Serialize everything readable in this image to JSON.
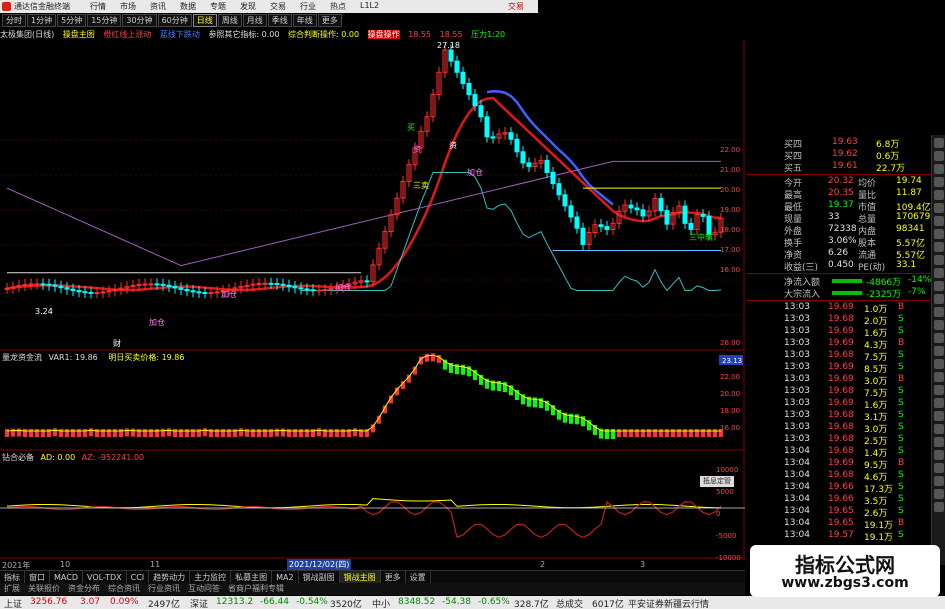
{
  "titlebar": {
    "app_title": "通达信金融终端",
    "menu": [
      "行情",
      "市场",
      "资讯",
      "数据",
      "专题",
      "发现",
      "交易",
      "行业",
      "热点",
      "L1L2"
    ],
    "right": "交易"
  },
  "periodbar": [
    "分时",
    "1分钟",
    "5分钟",
    "15分钟",
    "30分钟",
    "60分钟",
    "日线",
    "周线",
    "月线",
    "季线",
    "年线",
    "更多"
  ],
  "infoline": {
    "stock": "太极集团(日线)",
    "indicator": "操盘主图",
    "i1": "橙红线上涨动",
    "i2": "蓝线下跌动",
    "i3": "参照其它指标: 0.00",
    "i4": "综合判断操作: 0.00",
    "i5": "操盘操作",
    "v1": "18.55",
    "v2": "18.55",
    "pressure": "压力1:20"
  },
  "main_chart": {
    "peak_label": "27.18",
    "labels": {
      "buy": "买",
      "sell": "卖",
      "three_sell": "三卖",
      "three_buy1": "三中筑",
      "three_buy2": "三中筑",
      "add1": "加仓",
      "add2": "加仓",
      "add3": "加仓",
      "add4": "加仓",
      "low_label": "3.24",
      "fin": "财",
      "tag1": "资",
      "tag2": "资"
    },
    "y_ticks": [
      "22.00",
      "21.00",
      "20.00",
      "19.00",
      "18.00",
      "17.00",
      "16.00"
    ]
  },
  "sub1": {
    "title": "量龙资金流",
    "var1": "VAR1: 19.86",
    "var2": "明日买卖价格: 19.86",
    "y_ticks": [
      "26.00",
      "24.00",
      "22.00",
      "20.00",
      "18.00",
      "16.00"
    ],
    "highlight": "23.13"
  },
  "sub2": {
    "title": "钻合必备",
    "ad": "AD: 0.00",
    "az": "AZ: -952241.00",
    "y_ticks": [
      "10000",
      "5000",
      "0",
      "-5000",
      "-10000"
    ],
    "float_label": "抵息定管"
  },
  "dates": {
    "d1": "2021年",
    "d2": "10",
    "d3": "11",
    "d4": "2021/12/02(四)",
    "d5": "2",
    "d6": "3"
  },
  "quote": {
    "rows": [
      {
        "l": "买四",
        "p": "19.63",
        "v": "6.8万"
      },
      {
        "l": "买四",
        "p": "19.62",
        "v": "0.6万"
      },
      {
        "l": "买五",
        "p": "19.61",
        "v": "22.7万"
      }
    ],
    "stats": [
      {
        "l1": "今开",
        "v1": "20.32",
        "l2": "均价",
        "v2": "19.74"
      },
      {
        "l1": "最高",
        "v1": "20.35",
        "l2": "量比",
        "v2": "11.87"
      },
      {
        "l1": "最低",
        "v1": "19.37",
        "l2": "市值",
        "v2": "109.4亿"
      },
      {
        "l1": "现量",
        "v1": "33",
        "l2": "总量",
        "v2": "170679"
      },
      {
        "l1": "外盘",
        "v1": "72338",
        "l2": "内盘",
        "v2": "98341"
      },
      {
        "l1": "换手",
        "v1": "3.06%",
        "l2": "股本",
        "v2": "5.57亿"
      },
      {
        "l1": "净资",
        "v1": "6.26",
        "l2": "流通",
        "v2": "5.57亿"
      },
      {
        "l1": "收益(三)",
        "v1": "0.450",
        "l2": "PE(动)",
        "v2": "33.1"
      }
    ],
    "flow": [
      {
        "l": "净流入额",
        "v": "-4866万",
        "p": "-14%"
      },
      {
        "l": "大宗流入",
        "v": "-2325万",
        "p": "-7%"
      }
    ],
    "ticks": [
      {
        "t": "13:03",
        "p": "19.69",
        "v": "1.0万",
        "s": "B"
      },
      {
        "t": "13:03",
        "p": "19.68",
        "v": "2.0万",
        "s": "S"
      },
      {
        "t": "13:03",
        "p": "19.69",
        "v": "1.6万",
        "s": "S"
      },
      {
        "t": "13:03",
        "p": "19.69",
        "v": "4.3万",
        "s": "B"
      },
      {
        "t": "13:03",
        "p": "19.68",
        "v": "7.5万",
        "s": "S"
      },
      {
        "t": "13:03",
        "p": "19.69",
        "v": "8.5万",
        "s": "S"
      },
      {
        "t": "13:03",
        "p": "19.69",
        "v": "3.0万",
        "s": "B"
      },
      {
        "t": "13:03",
        "p": "19.68",
        "v": "7.5万",
        "s": "S"
      },
      {
        "t": "13:03",
        "p": "19.69",
        "v": "1.6万",
        "s": "S"
      },
      {
        "t": "13:03",
        "p": "19.68",
        "v": "3.1万",
        "s": "S"
      },
      {
        "t": "13:03",
        "p": "19.68",
        "v": "3.0万",
        "s": "S"
      },
      {
        "t": "13:03",
        "p": "19.68",
        "v": "2.5万",
        "s": "S"
      },
      {
        "t": "13:04",
        "p": "19.68",
        "v": "1.4万",
        "s": "S"
      },
      {
        "t": "13:04",
        "p": "19.69",
        "v": "9.5万",
        "s": "B"
      },
      {
        "t": "13:04",
        "p": "19.68",
        "v": "4.6万",
        "s": "S"
      },
      {
        "t": "13:04",
        "p": "19.66",
        "v": "17.3万",
        "s": "S"
      },
      {
        "t": "13:04",
        "p": "19.66",
        "v": "3.5万",
        "s": "S"
      },
      {
        "t": "13:04",
        "p": "19.65",
        "v": "2.6万",
        "s": "S"
      },
      {
        "t": "13:04",
        "p": "19.65",
        "v": "19.1万",
        "s": "B"
      },
      {
        "t": "13:04",
        "p": "19.57",
        "v": "19.1万",
        "s": "S"
      }
    ]
  },
  "tabs": [
    "指标",
    "窗口",
    "MACD",
    "VOL-TDX",
    "CCI",
    "趋势动力",
    "主力监控",
    "私募主图",
    "MA2",
    "钢战副图",
    "钢战主图",
    "更多",
    "设置"
  ],
  "tabs2": [
    "扩展",
    "关联报价",
    "资金分布",
    "综合资讯",
    "行业资讯",
    "互动问答",
    "省商户福利专辑"
  ],
  "status": {
    "sh_name": "上证",
    "sh_val": "3256.76",
    "sh_chg": "3.07",
    "sh_pct": "0.09%",
    "sh_amt": "2497亿",
    "sz_name": "深证",
    "sz_val": "12313.2",
    "sz_chg": "-66.44",
    "sz_pct": "-0.54%",
    "sz_amt": "3520亿",
    "zx_name": "中小",
    "zx_val": "8348.52",
    "zx_chg": "-54.38",
    "zx_pct": "-0.65%",
    "zx_amt": "328.7亿",
    "total_label": "总成交",
    "total_val": "6017亿",
    "broker": "平安证券新疆云行情"
  },
  "watermark": {
    "line1": "指标公式网",
    "line2": "www.zbgs3.com"
  },
  "colors": {
    "up": "#ff3030",
    "down": "#00ff00",
    "ma_red": "#e01818",
    "ma_blue": "#4060ff",
    "ma_cyan": "#30c0c0"
  }
}
